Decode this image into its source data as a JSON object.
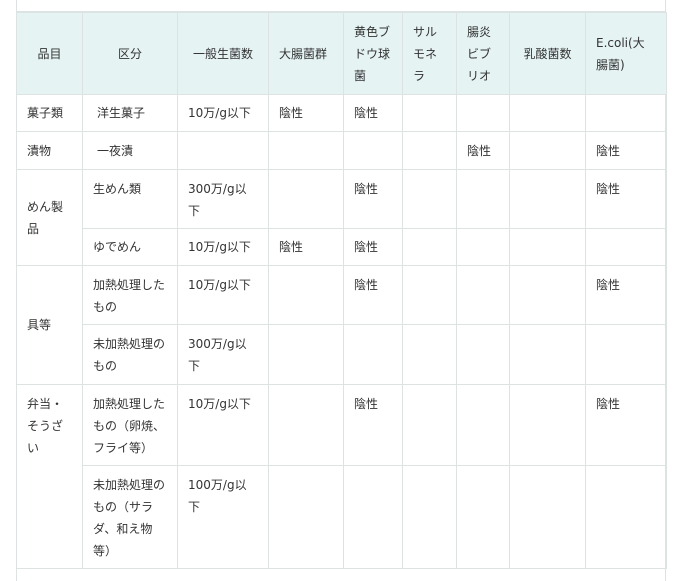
{
  "table": {
    "headers": [
      "品目",
      "区分",
      "一般生菌数",
      "大腸菌群",
      "黄色ブドウ球菌",
      "サルモネラ",
      "腸炎ビブリオ",
      "乳酸菌数",
      "E.coli(大腸菌)"
    ],
    "rows": [
      {
        "item": "菓子類",
        "category": "洋生菓子",
        "general": "10万/g以下",
        "coliform": "陰性",
        "staph": "陰性",
        "salmonella": "",
        "vibrio": "",
        "lactic": "",
        "ecoli": ""
      },
      {
        "item": "漬物",
        "category": "一夜漬",
        "general": "",
        "coliform": "",
        "staph": "",
        "salmonella": "",
        "vibrio": "陰性",
        "lactic": "",
        "ecoli": "陰性"
      },
      {
        "item": "めん製品",
        "category": "生めん類",
        "general": "300万/g以下",
        "coliform": "",
        "staph": "陰性",
        "salmonella": "",
        "vibrio": "",
        "lactic": "",
        "ecoli": "陰性"
      },
      {
        "item": "",
        "category": "ゆでめん",
        "general": "10万/g以下",
        "coliform": "陰性",
        "staph": "陰性",
        "salmonella": "",
        "vibrio": "",
        "lactic": "",
        "ecoli": ""
      },
      {
        "item": "具等",
        "category": "加熱処理したもの",
        "general": "10万/g以下",
        "coliform": "",
        "staph": "陰性",
        "salmonella": "",
        "vibrio": "",
        "lactic": "",
        "ecoli": "陰性"
      },
      {
        "item": "",
        "category": "未加熱処理のもの",
        "general": "300万/g以下",
        "coliform": "",
        "staph": "",
        "salmonella": "",
        "vibrio": "",
        "lactic": "",
        "ecoli": ""
      },
      {
        "item": "弁当・そうざい",
        "category": "加熱処理したもの（卵焼、フライ等）",
        "general": "10万/g以下",
        "coliform": "",
        "staph": "陰性",
        "salmonella": "",
        "vibrio": "",
        "lactic": "",
        "ecoli": "陰性"
      },
      {
        "item": "",
        "category": "未加熱処理のもの（サラダ、和え物等）",
        "general": "100万/g以下",
        "coliform": "",
        "staph": "",
        "salmonella": "",
        "vibrio": "",
        "lactic": "",
        "ecoli": ""
      }
    ]
  }
}
